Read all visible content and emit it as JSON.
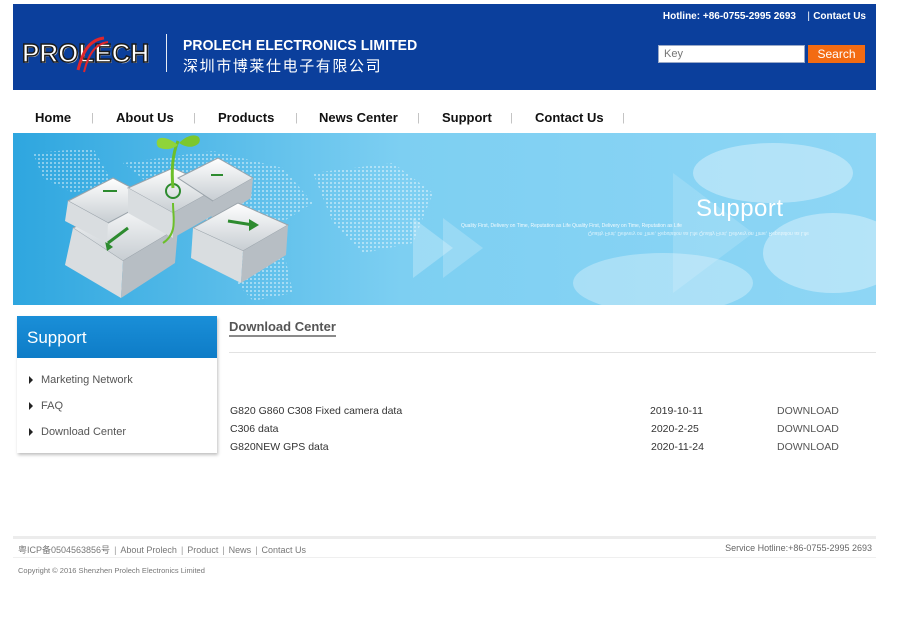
{
  "header": {
    "logo_text": "PROLECH",
    "company_en": "PROLECH ELECTRONICS LIMITED",
    "company_cn": "深圳市博莱仕电子有限公司",
    "hotline": "Hotline: +86-0755-2995 2693",
    "hotline_sep": "|",
    "contact_link": "Contact Us",
    "search_placeholder": "Key",
    "search_button": "Search",
    "colors": {
      "bar": "#0b3f9c",
      "search_button": "#f36b12"
    }
  },
  "nav": {
    "items": [
      "Home",
      "About Us",
      "Products",
      "News Center",
      "Support",
      "Contact Us"
    ],
    "separator": "|"
  },
  "banner": {
    "title": "Support",
    "tagline": "Quality First, Delivery on Time, Reputation as Life Quality First, Delivery on Time, Reputation as Life"
  },
  "sidebar": {
    "title": "Support",
    "items": [
      "Marketing Network",
      "FAQ",
      "Download Center"
    ]
  },
  "content": {
    "title": "Download Center",
    "rows": [
      {
        "name": "G820 G860 C308  Fixed camera data",
        "date": "2019-10-11",
        "action": "DOWNLOAD"
      },
      {
        "name": "C306 data",
        "date": "2020-2-25",
        "action": "DOWNLOAD"
      },
      {
        "name": "G820NEW GPS data",
        "date": "2020-11-24",
        "action": "DOWNLOAD"
      }
    ]
  },
  "footer": {
    "links": [
      "粤ICP备0504563856号",
      "About Prolech",
      "Product",
      "News",
      "Contact Us"
    ],
    "hotline": "Service Hotline:+86-0755-2995 2693",
    "copyright": "Copyright © 2016 Shenzhen Prolech Electronics Limited"
  }
}
